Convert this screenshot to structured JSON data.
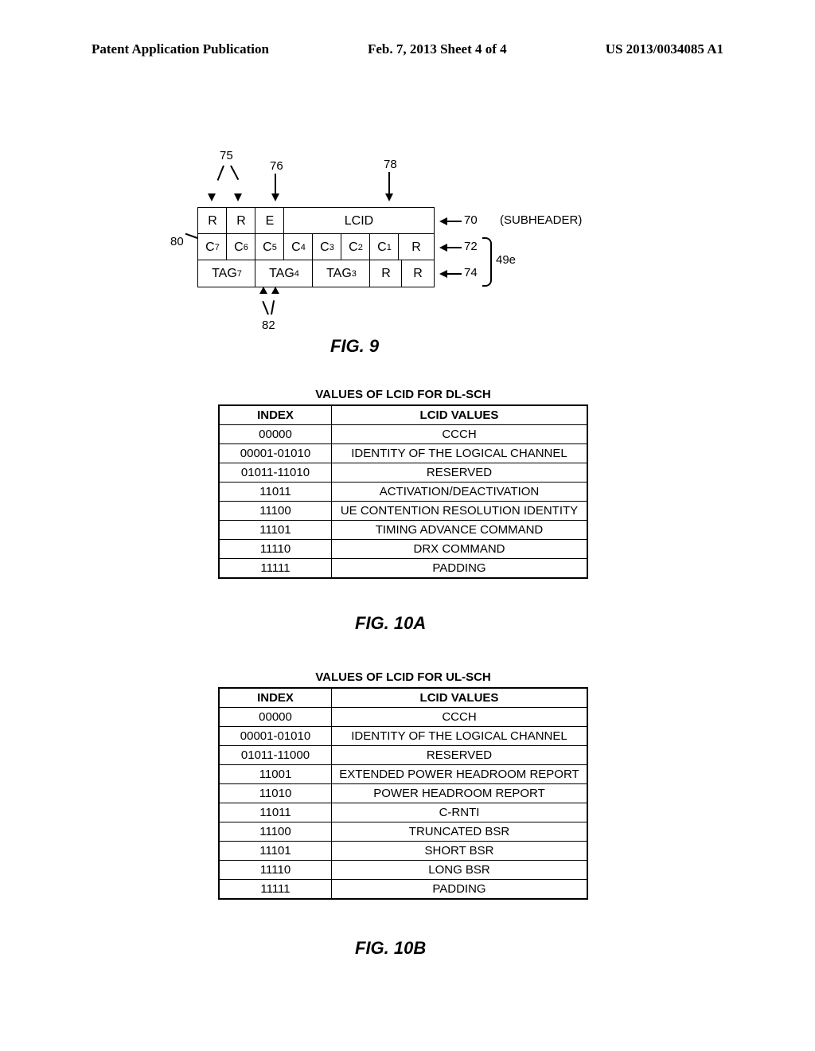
{
  "header": {
    "left": "Patent Application Publication",
    "center": "Feb. 7, 2013  Sheet 4 of 4",
    "right": "US 2013/0034085 A1"
  },
  "fig9": {
    "row1": {
      "c0": "R",
      "c1": "R",
      "c2": "E",
      "lcid": "LCID"
    },
    "row2": {
      "c0": "C",
      "s0": "7",
      "c1": "C",
      "s1": "6",
      "c2": "C",
      "s2": "5",
      "c3": "C",
      "s3": "4",
      "c4": "C",
      "s4": "3",
      "c5": "C",
      "s5": "2",
      "c6": "C",
      "s6": "1",
      "c7": "R"
    },
    "row3": {
      "t0": "TAG",
      "ts0": "7",
      "t1": "TAG",
      "ts1": "4",
      "t2": "TAG",
      "ts2": "3",
      "r0": "R",
      "r1": "R"
    },
    "labels": {
      "l75": "75",
      "l76": "76",
      "l78": "78",
      "l80": "80",
      "l82": "82",
      "l70": "70",
      "l72": "72",
      "l74": "74",
      "l49e": "49e",
      "subheader": "(SUBHEADER)"
    },
    "caption": "FIG. 9"
  },
  "tableA": {
    "title": "VALUES OF LCID FOR DL-SCH",
    "head": {
      "index": "INDEX",
      "values": "LCID VALUES"
    },
    "rows": [
      {
        "index": "00000",
        "val": "CCCH"
      },
      {
        "index": "00001-01010",
        "val": "IDENTITY OF THE LOGICAL CHANNEL"
      },
      {
        "index": "01011-11010",
        "val": "RESERVED"
      },
      {
        "index": "11011",
        "val": "ACTIVATION/DEACTIVATION"
      },
      {
        "index": "11100",
        "val": "UE CONTENTION RESOLUTION IDENTITY"
      },
      {
        "index": "11101",
        "val": "TIMING ADVANCE COMMAND"
      },
      {
        "index": "11110",
        "val": "DRX COMMAND"
      },
      {
        "index": "11111",
        "val": "PADDING"
      }
    ],
    "caption": "FIG. 10A"
  },
  "tableB": {
    "title": "VALUES OF LCID FOR UL-SCH",
    "head": {
      "index": "INDEX",
      "values": "LCID VALUES"
    },
    "rows": [
      {
        "index": "00000",
        "val": "CCCH"
      },
      {
        "index": "00001-01010",
        "val": "IDENTITY OF THE LOGICAL CHANNEL"
      },
      {
        "index": "01011-11000",
        "val": "RESERVED"
      },
      {
        "index": "11001",
        "val": "EXTENDED POWER HEADROOM REPORT"
      },
      {
        "index": "11010",
        "val": "POWER HEADROOM REPORT"
      },
      {
        "index": "11011",
        "val": "C-RNTI"
      },
      {
        "index": "11100",
        "val": "TRUNCATED BSR"
      },
      {
        "index": "11101",
        "val": "SHORT BSR"
      },
      {
        "index": "11110",
        "val": "LONG BSR"
      },
      {
        "index": "11111",
        "val": "PADDING"
      }
    ],
    "caption": "FIG. 10B"
  }
}
